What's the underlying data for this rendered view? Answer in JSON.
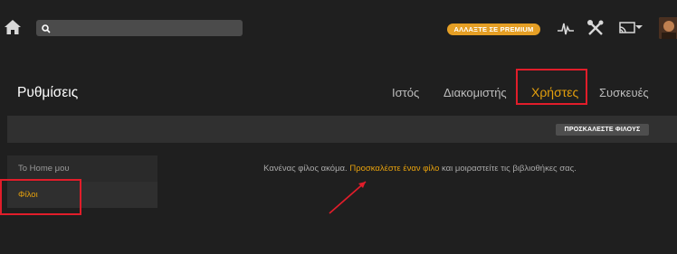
{
  "topbar": {
    "search_placeholder": "",
    "premium_label": "ΑΛΛΑΞΤΕ ΣΕ PREMIUM",
    "icons": [
      "home-icon",
      "search-icon",
      "activity-icon",
      "tools-icon",
      "cast-icon",
      "chevron-down-icon",
      "avatar"
    ]
  },
  "header": {
    "title": "Ρυθμίσεις",
    "tabs": [
      {
        "label": "Ιστός",
        "active": false
      },
      {
        "label": "Διακομιστής",
        "active": false
      },
      {
        "label": "Χρήστες",
        "active": true
      },
      {
        "label": "Συσκευές",
        "active": false
      }
    ]
  },
  "actionbar": {
    "invite_label": "ΠΡΟΣΚΑΛΕΣΤΕ ΦΙΛΟΥΣ"
  },
  "sidebar": {
    "items": [
      {
        "label": "Το Home μου",
        "active": false
      },
      {
        "label": "Φίλοι",
        "active": true
      }
    ]
  },
  "main": {
    "message_before": "Κανένας φίλος ακόμα. ",
    "message_link": "Προσκαλέστε έναν φίλο",
    "message_after": " και μοιραστείτε τις βιβλιοθήκες σας."
  },
  "colors": {
    "accent": "#e5a00d",
    "premium": "#e59f25",
    "annotation": "#e11d2a",
    "background": "#1f1f1f"
  }
}
